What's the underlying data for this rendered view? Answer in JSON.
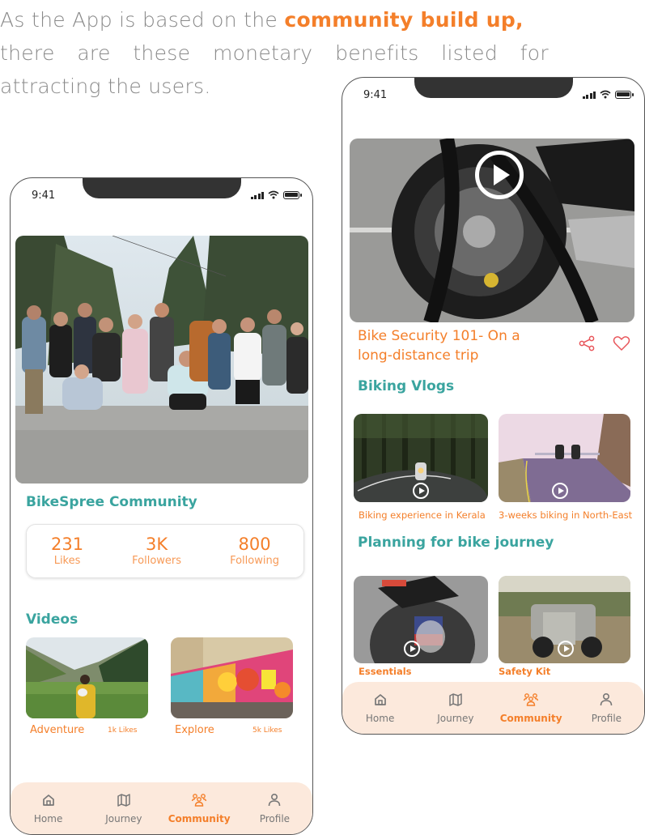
{
  "intro": {
    "line1_prefix": "As the App is based on the ",
    "line1_highlight": "community build up,",
    "line2_words": [
      "there",
      "are",
      "these",
      "monetary",
      "benefits",
      "listed",
      "for"
    ],
    "line3": "attracting the users."
  },
  "colors": {
    "accent_orange": "#f47f2a",
    "accent_teal": "#3aa49f",
    "tabbar_bg": "#fce9dc",
    "muted_gray": "#777777"
  },
  "status_bar": {
    "time": "9:41"
  },
  "phone1": {
    "hero_image": "group-photo",
    "community_title": "BikeSpree Community",
    "stats": [
      {
        "value": "231",
        "label": "Likes"
      },
      {
        "value": "3K",
        "label": "Followers"
      },
      {
        "value": "800",
        "label": "Following"
      }
    ],
    "videos_title": "Videos",
    "videos": [
      {
        "title": "Adventure",
        "likes": "1k Likes",
        "image": "hiker-valley"
      },
      {
        "title": "Explore",
        "likes": "5k Likes",
        "image": "graffiti-wall"
      }
    ]
  },
  "phone2": {
    "featured": {
      "image": "bike-wheel-lock",
      "title_line1": "Bike Security 101- On a",
      "title_line2": "long-distance trip"
    },
    "vlogs_title": "Biking Vlogs",
    "vlogs": [
      {
        "caption": "Biking experience in Kerala",
        "image": "forest-road-rider"
      },
      {
        "caption": "3-weeks biking in North-East",
        "image": "two-riders-road"
      }
    ],
    "planning_title": "Planning for bike journey",
    "planning": [
      {
        "caption": "Essentials",
        "image": "helmet-gloves"
      },
      {
        "caption": "Safety Kit",
        "image": "adventure-bike"
      }
    ]
  },
  "tabbar": {
    "items": [
      {
        "label": "Home",
        "icon": "home-icon",
        "active": false
      },
      {
        "label": "Journey",
        "icon": "map-icon",
        "active": false
      },
      {
        "label": "Community",
        "icon": "community-icon",
        "active": true
      },
      {
        "label": "Profile",
        "icon": "profile-icon",
        "active": false
      }
    ]
  }
}
